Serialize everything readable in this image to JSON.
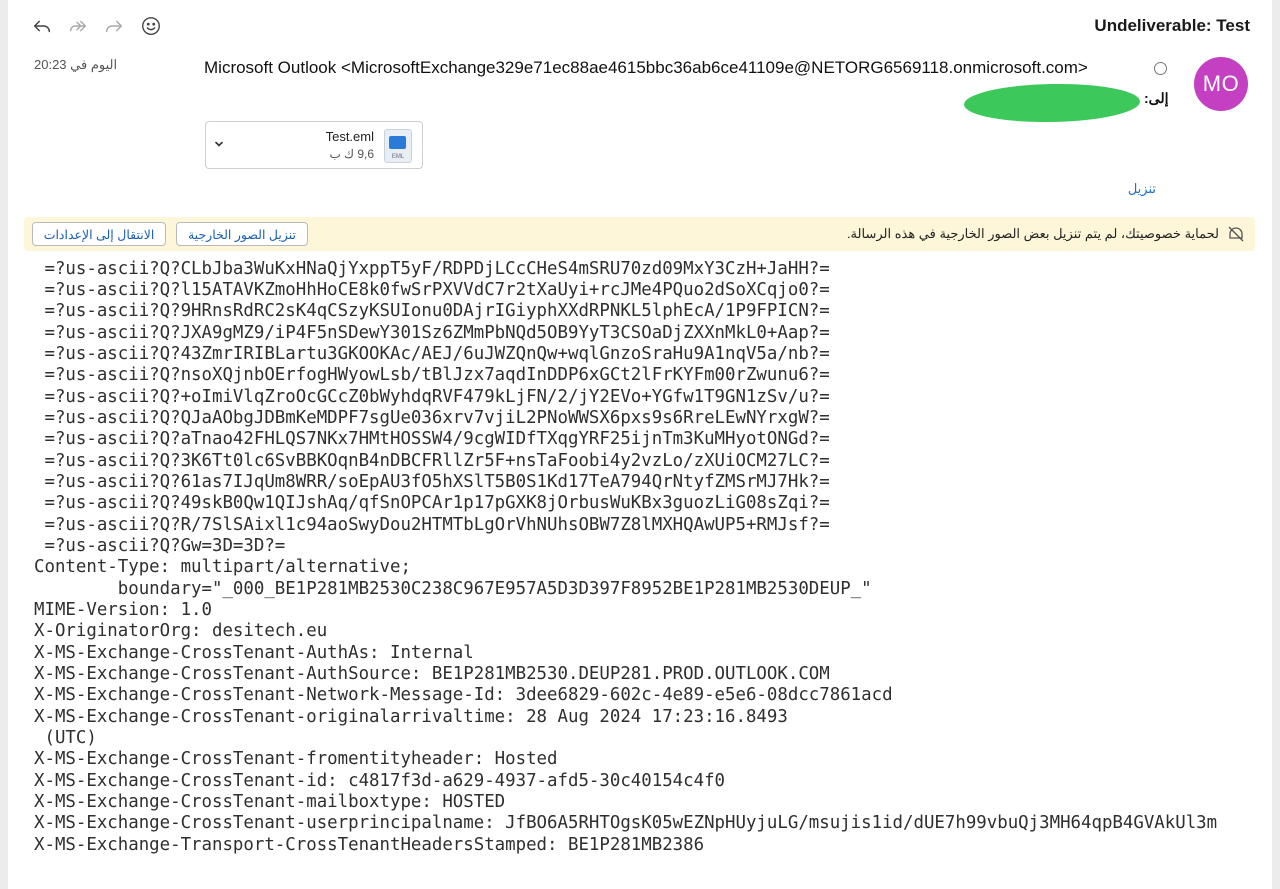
{
  "toolbar": {
    "icons": [
      "reply-icon",
      "reply-all-icon",
      "forward-icon",
      "emoji-icon"
    ]
  },
  "message": {
    "subject": "Undeliverable: Test",
    "date": "اليوم في 20:23",
    "sender": "Microsoft Outlook <MicrosoftExchange329e71ec88ae4615bbc36ab6ce41109e@NETORG6569118.onmicrosoft.com>",
    "to_label": "إلى:",
    "avatar_initials": "MO",
    "avatar_color": "#c43fc1"
  },
  "attachment": {
    "name": "Test.eml",
    "size": "9,6 ك ب",
    "file_ext": "EML"
  },
  "download_label": "تنزيل",
  "privacy_banner": {
    "text": "لحماية خصوصيتك، لم يتم تنزيل بعض الصور الخارجية في هذه الرسالة.",
    "download_images_button": "تنزيل الصور الخارجية",
    "settings_button": "الانتقال إلى الإعدادات",
    "background": "#fdf6d9"
  },
  "body_lines": [
    " =?us-ascii?Q?CLbJba3WuKxHNaQjYxppT5yF/RDPDjLCcCHeS4mSRU70zd09MxY3CzH+JaHH?=",
    " =?us-ascii?Q?l15ATAVKZmoHhHoCE8k0fwSrPXVVdC7r2tXaUyi+rcJMe4PQuo2dSoXCqjo0?=",
    " =?us-ascii?Q?9HRnsRdRC2sK4qCSzyKSUIonu0DAjrIGiyphXXdRPNKL5lphEcA/1P9FPICN?=",
    " =?us-ascii?Q?JXA9gMZ9/iP4F5nSDewY301Sz6ZMmPbNQd5OB9YyT3CSOaDjZXXnMkL0+Aap?=",
    " =?us-ascii?Q?43ZmrIRIBLartu3GKOOKAc/AEJ/6uJWZQnQw+wqlGnzoSraHu9A1nqV5a/nb?=",
    " =?us-ascii?Q?nsoXQjnbOErfogHWyowLsb/tBlJzx7aqdInDDP6xGCt2lFrKYFm00rZwunu6?=",
    " =?us-ascii?Q?+oImiVlqZroOcGCcZ0bWyhdqRVF479kLjFN/2/jY2EVo+YGfw1T9GN1zSv/u?=",
    " =?us-ascii?Q?QJaAObgJDBmKeMDPF7sgUe036xrv7vjiL2PNoWWSX6pxs9s6RreLEwNYrxgW?=",
    " =?us-ascii?Q?aTnao42FHLQS7NKx7HMtHOSSW4/9cgWIDfTXqgYRF25ijnTm3KuMHyotONGd?=",
    " =?us-ascii?Q?3K6Tt0lc6SvBBKOqnB4nDBCFRllZr5F+nsTaFoobi4y2vzLo/zXUiOCM27LC?=",
    " =?us-ascii?Q?61as7IJqUm8WRR/soEpAU3fO5hXSlT5B0S1Kd17TeA794QrNtyfZMSrMJ7Hk?=",
    " =?us-ascii?Q?49skB0Qw1QIJshAq/qfSnOPCAr1p17pGXK8jOrbusWuKBx3guozLiG08sZqi?=",
    " =?us-ascii?Q?R/7SlSAixl1c94aoSwyDou2HTMTbLgOrVhNUhsOBW7Z8lMXHQAwUP5+RMJsf?=",
    " =?us-ascii?Q?Gw=3D=3D?=",
    "Content-Type: multipart/alternative;",
    "        boundary=\"_000_BE1P281MB2530C238C967E957A5D3D397F8952BE1P281MB2530DEUP_\"",
    "MIME-Version: 1.0",
    "X-OriginatorOrg: desitech.eu",
    "X-MS-Exchange-CrossTenant-AuthAs: Internal",
    "X-MS-Exchange-CrossTenant-AuthSource: BE1P281MB2530.DEUP281.PROD.OUTLOOK.COM",
    "X-MS-Exchange-CrossTenant-Network-Message-Id: 3dee6829-602c-4e89-e5e6-08dcc7861acd",
    "X-MS-Exchange-CrossTenant-originalarrivaltime: 28 Aug 2024 17:23:16.8493",
    " (UTC)",
    "X-MS-Exchange-CrossTenant-fromentityheader: Hosted",
    "X-MS-Exchange-CrossTenant-id: c4817f3d-a629-4937-afd5-30c40154c4f0",
    "X-MS-Exchange-CrossTenant-mailboxtype: HOSTED",
    "X-MS-Exchange-CrossTenant-userprincipalname: JfBO6A5RHTOgsK05wEZNpHUyjuLG/msujis1id/dUE7h99vbuQj3MH64qpB4GVAkUl3m",
    "X-MS-Exchange-Transport-CrossTenantHeadersStamped: BE1P281MB2386"
  ]
}
